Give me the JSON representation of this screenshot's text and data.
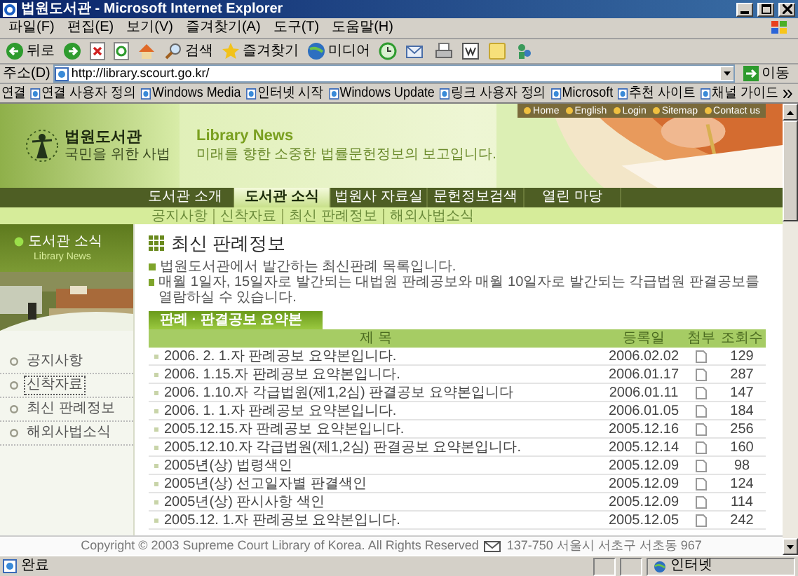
{
  "window": {
    "title": "법원도서관 - Microsoft Internet Explorer"
  },
  "menu": [
    "파일(F)",
    "편집(E)",
    "보기(V)",
    "즐겨찾기(A)",
    "도구(T)",
    "도움말(H)"
  ],
  "toolbar": {
    "back": "뒤로",
    "search": "검색",
    "favorites": "즐겨찾기",
    "media": "미디어"
  },
  "address": {
    "label": "주소(D)",
    "value": "http://library.scourt.go.kr/",
    "go": "이동"
  },
  "links": {
    "label": "연결",
    "items": [
      "연결 사용자 정의",
      "Windows Media",
      "인터넷 시작",
      "Windows Update",
      "링크 사용자 정의",
      "Microsoft",
      "추천 사이트",
      "채널 가이드"
    ]
  },
  "site": {
    "logo": "법원도서관",
    "slogan": "국민을 위한 사법",
    "heading": "Library News",
    "tagline": "미래를 향한 소중한 법률문헌정보의 보고입니다.",
    "top_links": [
      "Home",
      "English",
      "Login",
      "Sitemap",
      "Contact us"
    ],
    "nav": [
      {
        "label": "도서관 소개",
        "selected": false
      },
      {
        "label": "도서관 소식",
        "selected": true
      },
      {
        "label": "법원사 자료실",
        "selected": false
      },
      {
        "label": "문헌정보검색",
        "selected": false
      },
      {
        "label": "열린 마당",
        "selected": false
      }
    ],
    "subnav": [
      "공지사항",
      "신착자료",
      "최신 판례정보",
      "해외사법소식"
    ]
  },
  "sidebar": {
    "title": "도서관 소식",
    "subtitle": "Library News",
    "items": [
      {
        "label": "공지사항",
        "focused": false
      },
      {
        "label": "신착자료",
        "focused": true
      },
      {
        "label": "최신 판례정보",
        "focused": false
      },
      {
        "label": "해외사법소식",
        "focused": false
      }
    ]
  },
  "main": {
    "title": "최신 판례정보",
    "notes": [
      "법원도서관에서 발간하는 최신판례 목록입니다.",
      "매월 1일자, 15일자로 발간되는 대법원 판례공보와 매월 10일자로 발간되는 각급법원 판결공보를 열람하실 수 있습니다."
    ],
    "table": {
      "tab": "판례 · 판결공보 요약본",
      "columns": [
        "제 목",
        "등록일",
        "첨부",
        "조회수"
      ],
      "rows": [
        [
          "2006. 2. 1.자 판례공보 요약본입니다.",
          "2006.02.02",
          "129"
        ],
        [
          "2006. 1.15.자 판례공보 요약본입니다.",
          "2006.01.17",
          "287"
        ],
        [
          "2006. 1.10.자 각급법원(제1,2심) 판결공보 요약본입니다",
          "2006.01.11",
          "147"
        ],
        [
          "2006. 1. 1.자 판례공보 요약본입니다.",
          "2006.01.05",
          "184"
        ],
        [
          "2005.12.15.자 판례공보 요약본입니다.",
          "2005.12.16",
          "256"
        ],
        [
          "2005.12.10.자 각급법원(제1,2심) 판결공보 요약본입니다.",
          "2005.12.14",
          "160"
        ],
        [
          "2005년(상) 법령색인",
          "2005.12.09",
          "98"
        ],
        [
          "2005년(상) 선고일자별 판결색인",
          "2005.12.09",
          "124"
        ],
        [
          "2005년(상) 판시사항 색인",
          "2005.12.09",
          "114"
        ],
        [
          "2005.12. 1.자 판례공보 요약본입니다.",
          "2005.12.05",
          "242"
        ]
      ]
    }
  },
  "footer": {
    "copyright": "Copyright © 2003 Supreme Court Library of Korea. All Rights Reserved",
    "address": "137-750 서울시 서초구 서초동 967"
  },
  "status_bar": {
    "text": "완료",
    "zone": "인터넷"
  }
}
